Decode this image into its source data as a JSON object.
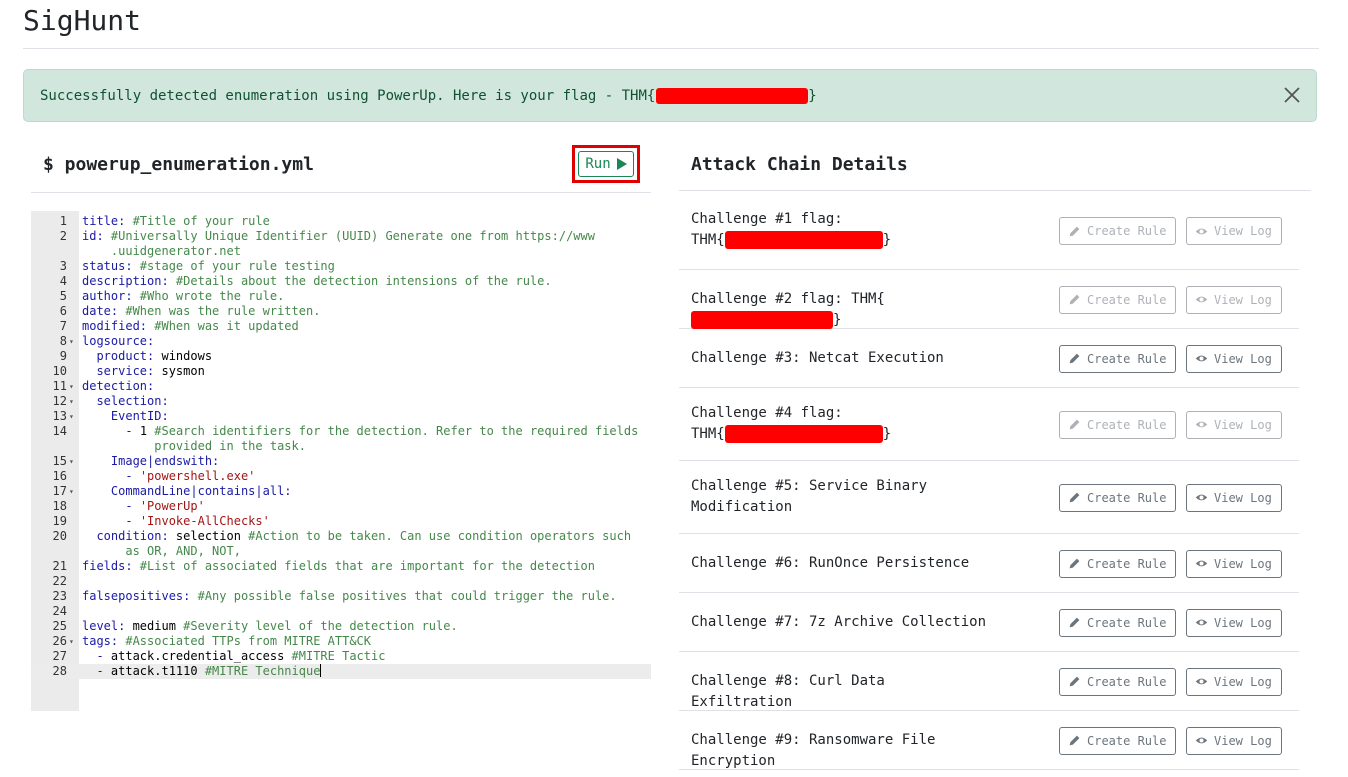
{
  "app": {
    "title": "SigHunt"
  },
  "alert": {
    "text_before": "Successfully detected enumeration using PowerUp. Here is your flag - THM{",
    "text_after": "}"
  },
  "editor": {
    "file_name": "$ powerup_enumeration.yml",
    "run_label": "Run",
    "lines": [
      {
        "n": "1",
        "key": "title:",
        "val": "",
        "comment": " #Title of your rule"
      },
      {
        "n": "2",
        "key": "id:",
        "val": "",
        "comment": " #Universally Unique Identifier (UUID) Generate one from https://www"
      },
      {
        "n": "",
        "key": "",
        "val": "",
        "comment": "    .uuidgenerator.net"
      },
      {
        "n": "3",
        "key": "status:",
        "val": "",
        "comment": " #stage of your rule testing"
      },
      {
        "n": "4",
        "key": "description:",
        "val": "",
        "comment": " #Details about the detection intensions of the rule."
      },
      {
        "n": "5",
        "key": "author:",
        "val": "",
        "comment": " #Who wrote the rule."
      },
      {
        "n": "6",
        "key": "date:",
        "val": "",
        "comment": " #When was the rule written."
      },
      {
        "n": "7",
        "key": "modified:",
        "val": "",
        "comment": " #When was it updated"
      },
      {
        "n": "8",
        "fold": true,
        "key": "logsource:",
        "val": "",
        "comment": ""
      },
      {
        "n": "9",
        "key": "  product:",
        "val": " windows",
        "comment": ""
      },
      {
        "n": "10",
        "key": "  service:",
        "val": " sysmon",
        "comment": ""
      },
      {
        "n": "11",
        "fold": true,
        "key": "detection:",
        "val": "",
        "comment": ""
      },
      {
        "n": "12",
        "fold": true,
        "key": "  selection:",
        "val": "",
        "comment": ""
      },
      {
        "n": "13",
        "fold": true,
        "key": "    EventID:",
        "val": "",
        "comment": ""
      },
      {
        "n": "14",
        "key": "      - ",
        "val": "1",
        "comment": " #Search identifiers for the detection. Refer to the required fields"
      },
      {
        "n": "",
        "key": "",
        "val": "",
        "comment": "          provided in the task."
      },
      {
        "n": "15",
        "fold": true,
        "key": "    Image|endswith:",
        "val": "",
        "comment": ""
      },
      {
        "n": "16",
        "key": "      - ",
        "val": "",
        "str": "'powershell.exe'",
        "comment": ""
      },
      {
        "n": "17",
        "fold": true,
        "key": "    CommandLine|contains|all:",
        "val": "",
        "comment": ""
      },
      {
        "n": "18",
        "key": "      - ",
        "val": "",
        "str": "'PowerUp'",
        "comment": ""
      },
      {
        "n": "19",
        "key": "      - ",
        "val": "",
        "str": "'Invoke-AllChecks'",
        "comment": ""
      },
      {
        "n": "20",
        "key": "  condition:",
        "val": " selection",
        "comment": " #Action to be taken. Can use condition operators such"
      },
      {
        "n": "",
        "key": "",
        "val": "",
        "comment": "      as OR, AND, NOT,"
      },
      {
        "n": "21",
        "key": "fields:",
        "val": "",
        "comment": " #List of associated fields that are important for the detection"
      },
      {
        "n": "22",
        "key": "",
        "val": "",
        "comment": ""
      },
      {
        "n": "23",
        "key": "falsepositives:",
        "val": "",
        "comment": " #Any possible false positives that could trigger the rule."
      },
      {
        "n": "24",
        "key": "",
        "val": "",
        "comment": ""
      },
      {
        "n": "25",
        "key": "level:",
        "val": " medium",
        "comment": " #Severity level of the detection rule."
      },
      {
        "n": "26",
        "fold": true,
        "key": "tags:",
        "val": "",
        "comment": " #Associated TTPs from MITRE ATT&CK"
      },
      {
        "n": "27",
        "key": "  - ",
        "val": "attack.credential_access",
        "comment": " #MITRE Tactic"
      },
      {
        "n": "28",
        "key": "  - ",
        "val": "attack.t1110",
        "comment": " #MITRE Technique",
        "active": true
      }
    ]
  },
  "details": {
    "title": "Attack Chain Details",
    "create_label": "Create Rule",
    "view_label": "View Log",
    "challenges": [
      {
        "label": "Challenge #1 flag:",
        "line2": "THM{",
        "redacted": true,
        "suffix": "}",
        "enabled": false
      },
      {
        "label": "Challenge #2 flag: THM{",
        "redacted": true,
        "suffix": "}",
        "enabled": false
      },
      {
        "label": "Challenge #3: Netcat Execution",
        "enabled": true
      },
      {
        "label": "Challenge #4 flag:",
        "line2": "THM{",
        "redacted": true,
        "suffix": "}",
        "enabled": false
      },
      {
        "label": "Challenge #5: Service Binary",
        "line2": "Modification",
        "enabled": true
      },
      {
        "label": "Challenge #6: RunOnce Persistence",
        "enabled": true
      },
      {
        "label": "Challenge #7: 7z Archive Collection",
        "enabled": true
      },
      {
        "label": "Challenge #8: Curl Data Exfiltration",
        "enabled": true
      },
      {
        "label": "Challenge #9: Ransomware File Encryption",
        "enabled": true
      }
    ]
  }
}
